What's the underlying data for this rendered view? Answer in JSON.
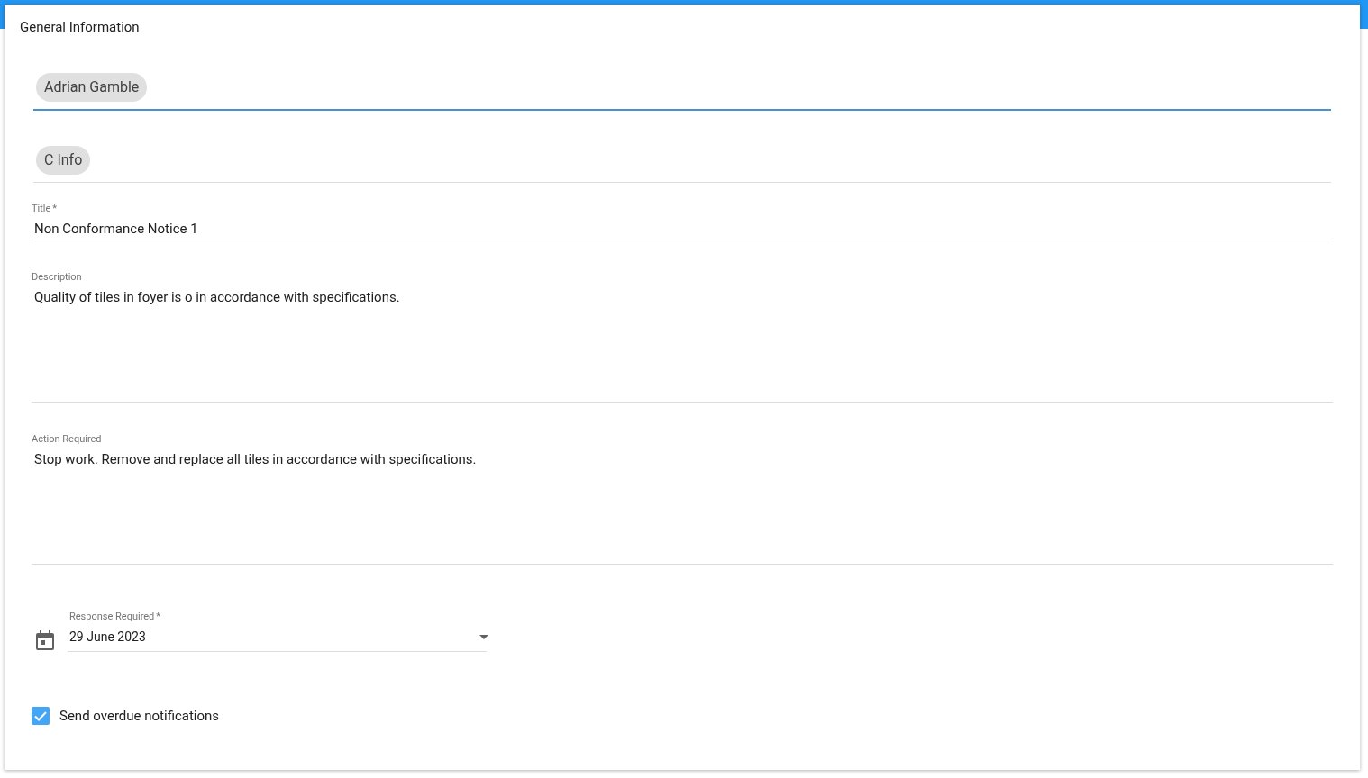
{
  "section_title": "General Information",
  "chip_fields": [
    {
      "chips": [
        "Adrian Gamble"
      ],
      "focused": true
    },
    {
      "chips": [
        "C Info"
      ],
      "focused": false
    }
  ],
  "text_fields": [
    {
      "label": "Title",
      "asterisk": "*",
      "value": "Non Conformance Notice 1",
      "multiline": false
    },
    {
      "label": "Description",
      "value": "Quality of tiles in foyer is o in accordance with specifications.",
      "multiline": true
    },
    {
      "label": "Action Required",
      "value": "Stop work. Remove and replace all tiles in accordance with specifications.",
      "multiline": true
    }
  ],
  "date_field": {
    "label": "Response Required",
    "asterisk": "*",
    "value": "29 June 2023"
  },
  "checkbox": {
    "label": "Send overdue notifications",
    "checked": true
  }
}
